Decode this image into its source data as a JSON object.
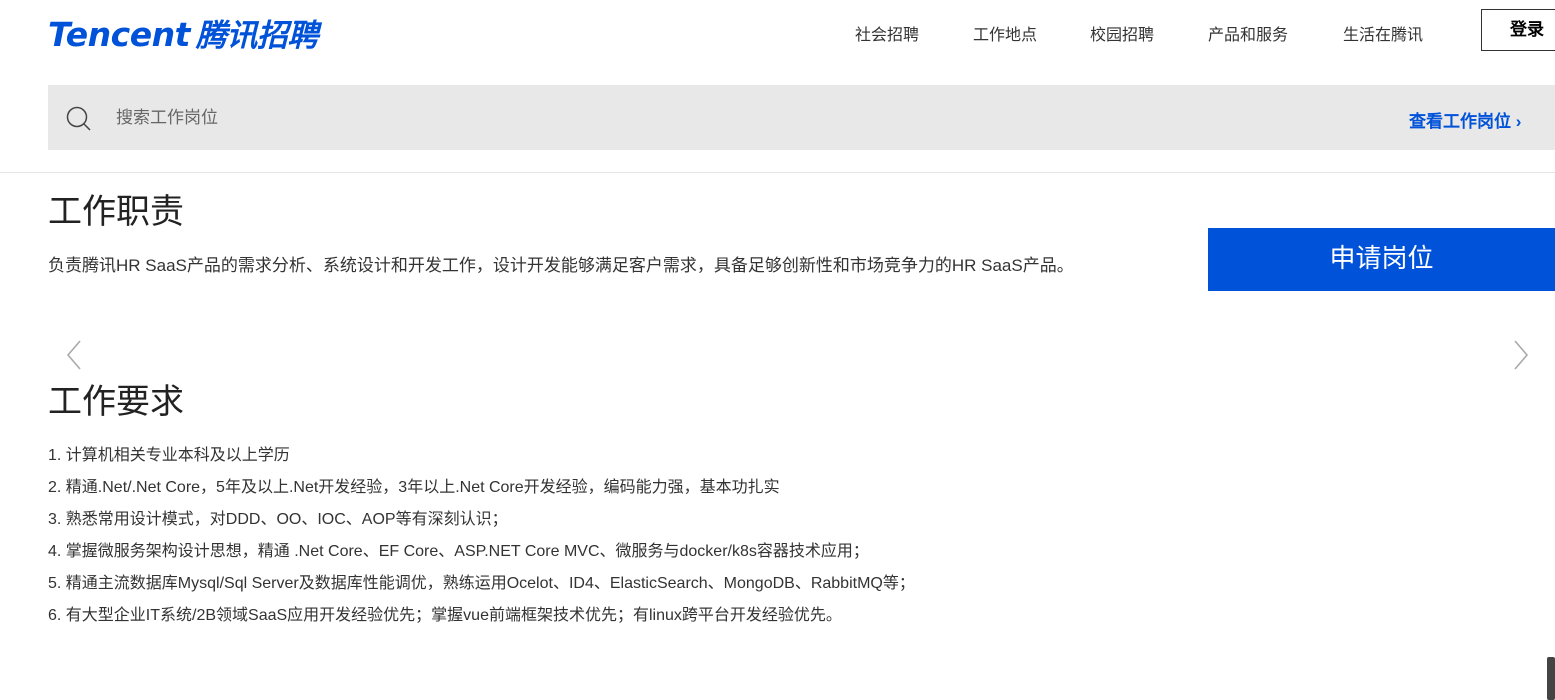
{
  "header": {
    "logo_en": "Tencent",
    "logo_cn": "腾讯招聘",
    "nav": [
      {
        "label": "社会招聘"
      },
      {
        "label": "工作地点"
      },
      {
        "label": "校园招聘"
      },
      {
        "label": "产品和服务"
      },
      {
        "label": "生活在腾讯"
      }
    ],
    "login_label": "登录"
  },
  "search": {
    "placeholder": "搜索工作岗位",
    "view_jobs_label": "查看工作岗位 ›",
    "icon": "search-icon"
  },
  "duty": {
    "title": "工作职责",
    "text": "负责腾讯HR SaaS产品的需求分析、系统设计和开发工作，设计开发能够满足客户需求，具备足够创新性和市场竞争力的HR SaaS产品。"
  },
  "apply_label": "申请岗位",
  "requirements": {
    "title": "工作要求",
    "items": [
      "1. 计算机相关专业本科及以上学历",
      "2. 精通.Net/.Net Core，5年及以上.Net开发经验，3年以上.Net Core开发经验，编码能力强，基本功扎实",
      "3. 熟悉常用设计模式，对DDD、OO、IOC、AOP等有深刻认识；",
      "4. 掌握微服务架构设计思想，精通 .Net Core、EF Core、ASP.NET Core MVC、微服务与docker/k8s容器技术应用；",
      "5. 精通主流数据库Mysql/Sql Server及数据库性能调优，熟练运用Ocelot、ID4、ElasticSearch、MongoDB、RabbitMQ等；",
      "6. 有大型企业IT系统/2B领域SaaS应用开发经验优先；掌握vue前端框架技术优先；有linux跨平台开发经验优先。"
    ]
  },
  "colors": {
    "brand": "#0052d9",
    "search_bg": "#e8e8e8",
    "text": "#333333"
  }
}
